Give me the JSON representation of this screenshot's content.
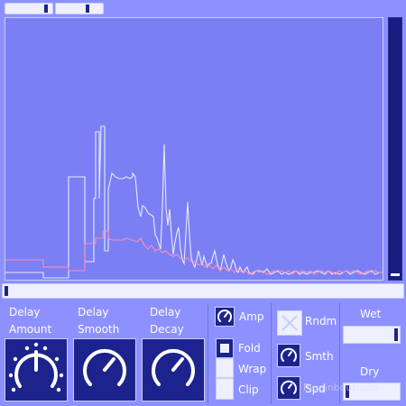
{
  "colors": {
    "background": "#8c91ff",
    "display_bg": "#7b7ff4",
    "trace_white": "#e8eaff",
    "trace_pink": "#ff8fb0",
    "control_dark": "#1d238c"
  },
  "delay": {
    "amount_label": "Delay\nAmount",
    "smooth_label": "Delay\nSmooth",
    "decay_label": "Delay\nDecay"
  },
  "mod": {
    "amp_label": "Amp",
    "fold_label": "Fold",
    "wrap_label": "Wrap",
    "clip_label": "Clip",
    "rndm_label": "Rndm",
    "smth_label": "Smth",
    "spd_label": "Spd"
  },
  "mix": {
    "wet_label": "Wet",
    "dry_label": "Dry"
  },
  "watermark": "Pluginboutique"
}
